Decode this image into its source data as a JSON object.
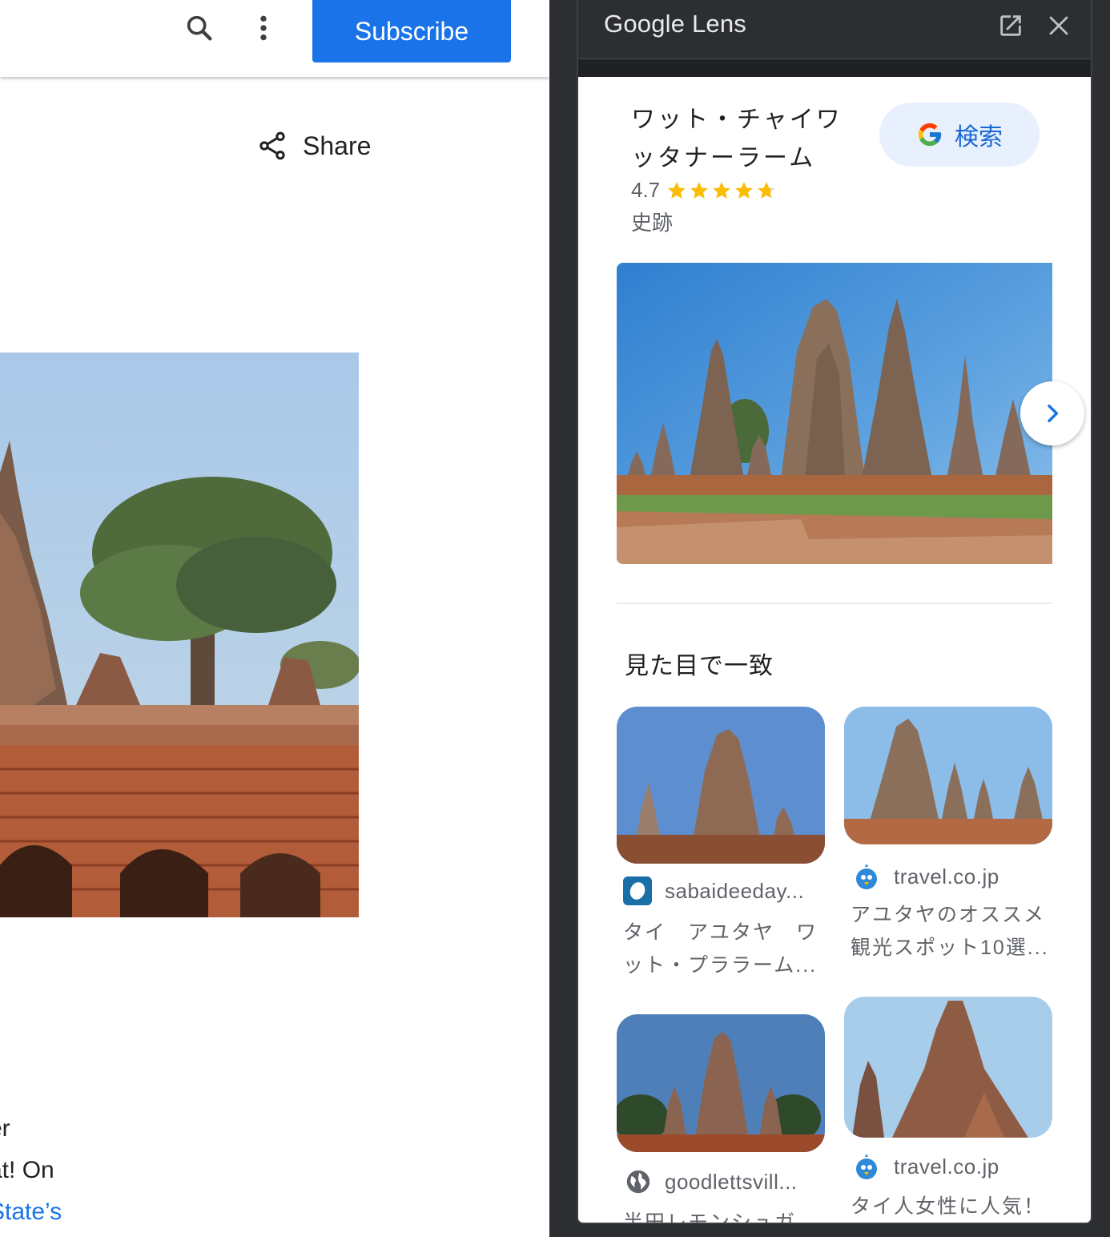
{
  "left_page": {
    "subscribe_label": "Subscribe",
    "share_label": "Share",
    "article_lines": [
      "er",
      "at! On",
      "State’s"
    ]
  },
  "lens": {
    "title": "Google Lens",
    "place_name": "ワット・チャイワッタナーラーム",
    "search_label": "検索",
    "rating": "4.7",
    "rating_value": 4.7,
    "category": "史跡",
    "section_title": "見た目で一致",
    "results": [
      {
        "source": "sabaideeday...",
        "title": "タイ　アユタヤ　ワット・プララーム..."
      },
      {
        "source": "travel.co.jp",
        "title": "アユタヤのオススメ観光スポット10選..."
      },
      {
        "source": "goodlettsvill...",
        "title": "半田レモンシュガ"
      },
      {
        "source": "travel.co.jp",
        "title": "タイ人女性に人気！"
      }
    ]
  },
  "colors": {
    "accent_blue": "#1a73e8",
    "panel_dark": "#2d2e31",
    "star_yellow": "#fbbc04"
  }
}
